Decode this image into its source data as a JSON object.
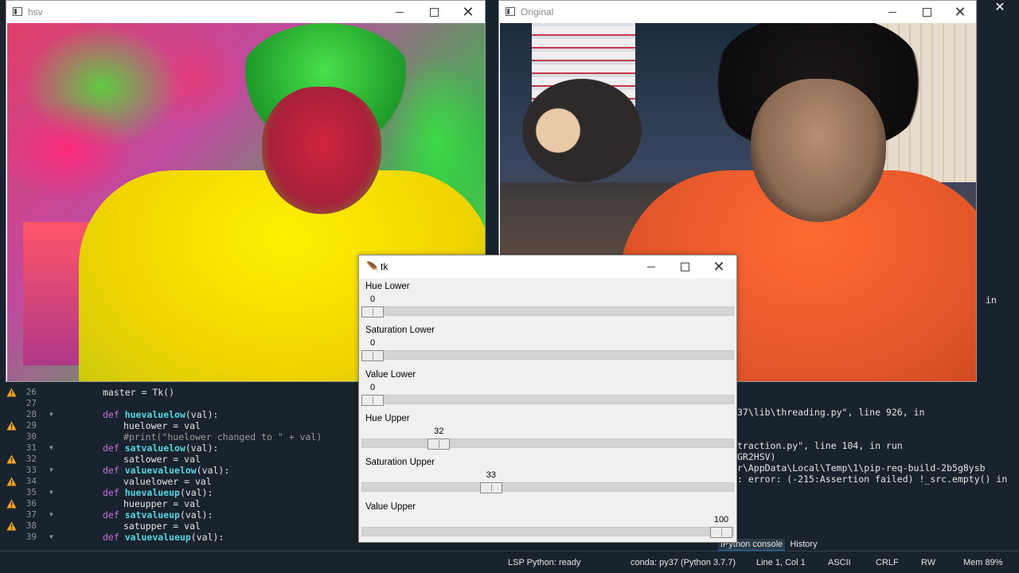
{
  "editor": {
    "lines": [
      {
        "n": "26",
        "warn": true,
        "fold": false,
        "indent": 0,
        "text": "master = Tk()"
      },
      {
        "n": "27",
        "warn": false,
        "fold": false,
        "indent": 0,
        "text": ""
      },
      {
        "n": "28",
        "warn": false,
        "fold": true,
        "indent": 0,
        "kw": "def ",
        "fn": "huevaluelow",
        "rest": "(val):"
      },
      {
        "n": "29",
        "warn": true,
        "fold": false,
        "indent": 1,
        "text": "huelower = val"
      },
      {
        "n": "30",
        "warn": false,
        "fold": false,
        "indent": 1,
        "comment": "#print(\"huelower changed to \" + val)"
      },
      {
        "n": "31",
        "warn": false,
        "fold": true,
        "indent": 0,
        "kw": "def ",
        "fn": "satvaluelow",
        "rest": "(val):"
      },
      {
        "n": "32",
        "warn": true,
        "fold": false,
        "indent": 1,
        "text": "satlower = val"
      },
      {
        "n": "33",
        "warn": false,
        "fold": true,
        "indent": 0,
        "kw": "def ",
        "fn": "valuevaluelow",
        "rest": "(val):"
      },
      {
        "n": "34",
        "warn": true,
        "fold": false,
        "indent": 1,
        "text": "valuelower = val"
      },
      {
        "n": "35",
        "warn": false,
        "fold": true,
        "indent": 0,
        "kw": "def ",
        "fn": "huevalueup",
        "rest": "(val):"
      },
      {
        "n": "36",
        "warn": true,
        "fold": false,
        "indent": 1,
        "text": "hueupper = val"
      },
      {
        "n": "37",
        "warn": false,
        "fold": true,
        "indent": 0,
        "kw": "def ",
        "fn": "satvalueup",
        "rest": "(val):"
      },
      {
        "n": "38",
        "warn": true,
        "fold": false,
        "indent": 1,
        "text": "satupper = val"
      },
      {
        "n": "39",
        "warn": false,
        "fold": true,
        "indent": 0,
        "kw": "def ",
        "fn": "valuevalueup",
        "rest": "(val):"
      }
    ]
  },
  "console": {
    "lines": [
      "37\\lib\\threading.py\", line 926, in",
      "",
      "",
      "traction.py\", line 104, in run",
      "GR2HSV)",
      "r\\AppData\\Local\\Temp\\1\\pip-req-build-2b5g8ysb",
      ": error: (-215:Assertion failed) !_src.empty() in"
    ],
    "side_in": "in"
  },
  "tabs": {
    "ipython": "IPython console",
    "history": "History"
  },
  "status": {
    "lsp": "LSP Python: ready",
    "conda": "conda: py37 (Python 3.7.7)",
    "position": "Line 1, Col 1",
    "encoding": "ASCII",
    "eol": "CRLF",
    "rw": "RW",
    "mem": "Mem 89%"
  },
  "windows": {
    "hsv_title": "hsv",
    "original_title": "Original",
    "tk_title": "tk"
  },
  "sliders": [
    {
      "label": "Hue Lower",
      "value": "0",
      "fraction": 0.0
    },
    {
      "label": "Saturation Lower",
      "value": "0",
      "fraction": 0.0
    },
    {
      "label": "Value Lower",
      "value": "0",
      "fraction": 0.0
    },
    {
      "label": "Hue Upper",
      "value": "32",
      "fraction": 0.19
    },
    {
      "label": "Saturation Upper",
      "value": "33",
      "fraction": 0.34
    },
    {
      "label": "Value Upper",
      "value": "100",
      "fraction": 1.0
    }
  ],
  "colors": {
    "keyword": "#c670e0",
    "function": "#57d6e4",
    "warning": "#f5a623"
  }
}
